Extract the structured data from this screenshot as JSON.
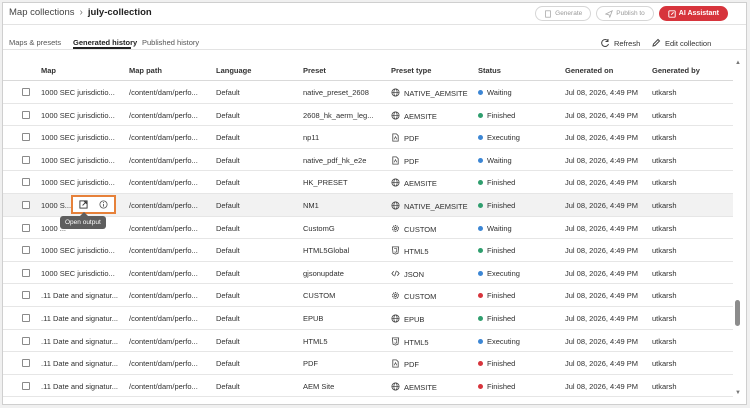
{
  "header": {
    "breadcrumb_parent": "Map collections",
    "breadcrumb_current": "july-collection",
    "generate_label": "Generate",
    "publish_label": "Publish to",
    "ai_label": "AI Assistant",
    "ai_color": "#d7343c"
  },
  "tabs": [
    {
      "label": "Maps & presets"
    },
    {
      "label": "Generated history"
    },
    {
      "label": "Published history"
    }
  ],
  "toolbar": {
    "refresh_label": "Refresh",
    "edit_label": "Edit collection"
  },
  "columns": [
    "Map",
    "Map path",
    "Language",
    "Preset",
    "Preset type",
    "Status",
    "Generated on",
    "Generated by"
  ],
  "status_colors": {
    "Waiting": "#3c86d4",
    "Finished": "#2f9e6e",
    "Executing": "#3c86d4"
  },
  "tooltip": "Open output",
  "rows": [
    {
      "map": "1000 SEC jurisdictio...",
      "path": "/content/dam/perfo...",
      "lang": "Default",
      "preset": "native_preset_2608",
      "type": "NATIVE_AEMSITE",
      "type_icon": "globe-icon",
      "status": "Waiting",
      "dot": "#3c86d4",
      "on": "Jul 08, 2026, 4:49 PM",
      "by": "utkarsh"
    },
    {
      "map": "1000 SEC jurisdictio...",
      "path": "/content/dam/perfo...",
      "lang": "Default",
      "preset": "2608_hk_aerm_leg...",
      "type": "AEMSITE",
      "type_icon": "globe-icon",
      "status": "Finished",
      "dot": "#2f9e6e",
      "on": "Jul 08, 2026, 4:49 PM",
      "by": "utkarsh"
    },
    {
      "map": "1000 SEC jurisdictio...",
      "path": "/content/dam/perfo...",
      "lang": "Default",
      "preset": "np11",
      "type": "PDF",
      "type_icon": "pdf-icon",
      "status": "Executing",
      "dot": "#3c86d4",
      "on": "Jul 08, 2026, 4:49 PM",
      "by": "utkarsh"
    },
    {
      "map": "1000 SEC jurisdictio...",
      "path": "/content/dam/perfo...",
      "lang": "Default",
      "preset": "native_pdf_hk_e2e",
      "type": "PDF",
      "type_icon": "pdf-icon",
      "status": "Waiting",
      "dot": "#3c86d4",
      "on": "Jul 08, 2026, 4:49 PM",
      "by": "utkarsh"
    },
    {
      "map": "1000 SEC jurisdictio...",
      "path": "/content/dam/perfo...",
      "lang": "Default",
      "preset": "HK_PRESET",
      "type": "AEMSITE",
      "type_icon": "globe-icon",
      "status": "Finished",
      "dot": "#2f9e6e",
      "on": "Jul 08, 2026, 4:49 PM",
      "by": "utkarsh"
    },
    {
      "map": "1000 S...",
      "path": "/content/dam/perfo...",
      "lang": "Default",
      "preset": "NM1",
      "type": "NATIVE_AEMSITE",
      "type_icon": "globe-icon",
      "status": "Finished",
      "dot": "#2f9e6e",
      "on": "Jul 08, 2026, 4:49 PM",
      "by": "utkarsh"
    },
    {
      "map": "1000 ...",
      "path": "/content/dam/perfo...",
      "lang": "Default",
      "preset": "CustomG",
      "type": "CUSTOM",
      "type_icon": "gear-icon",
      "status": "Waiting",
      "dot": "#3c86d4",
      "on": "Jul 08, 2026, 4:49 PM",
      "by": "utkarsh"
    },
    {
      "map": "1000 SEC jurisdictio...",
      "path": "/content/dam/perfo...",
      "lang": "Default",
      "preset": "HTML5Global",
      "type": "HTML5",
      "type_icon": "html5-icon",
      "status": "Finished",
      "dot": "#2f9e6e",
      "on": "Jul 08, 2026, 4:49 PM",
      "by": "utkarsh"
    },
    {
      "map": "1000 SEC jurisdictio...",
      "path": "/content/dam/perfo...",
      "lang": "Default",
      "preset": "gjsonupdate",
      "type": "JSON",
      "type_icon": "code-icon",
      "status": "Executing",
      "dot": "#3c86d4",
      "on": "Jul 08, 2026, 4:49 PM",
      "by": "utkarsh"
    },
    {
      "map": ".11 Date and signatur...",
      "path": "/content/dam/perfo...",
      "lang": "Default",
      "preset": "CUSTOM",
      "type": "CUSTOM",
      "type_icon": "gear-icon",
      "status": "Finished",
      "dot": "#d7343c",
      "on": "Jul 08, 2026, 4:49 PM",
      "by": "utkarsh"
    },
    {
      "map": ".11 Date and signatur...",
      "path": "/content/dam/perfo...",
      "lang": "Default",
      "preset": "EPUB",
      "type": "EPUB",
      "type_icon": "globe-icon",
      "status": "Finished",
      "dot": "#2f9e6e",
      "on": "Jul 08, 2026, 4:49 PM",
      "by": "utkarsh"
    },
    {
      "map": ".11 Date and signatur...",
      "path": "/content/dam/perfo...",
      "lang": "Default",
      "preset": "HTML5",
      "type": "HTML5",
      "type_icon": "html5-icon",
      "status": "Executing",
      "dot": "#3c86d4",
      "on": "Jul 08, 2026, 4:49 PM",
      "by": "utkarsh"
    },
    {
      "map": ".11 Date and signatur...",
      "path": "/content/dam/perfo...",
      "lang": "Default",
      "preset": "PDF",
      "type": "PDF",
      "type_icon": "pdf-icon",
      "status": "Finished",
      "dot": "#d7343c",
      "on": "Jul 08, 2026, 4:49 PM",
      "by": "utkarsh"
    },
    {
      "map": ".11 Date and signatur...",
      "path": "/content/dam/perfo...",
      "lang": "Default",
      "preset": "AEM Site",
      "type": "AEMSITE",
      "type_icon": "globe-icon",
      "status": "Finished",
      "dot": "#d7343c",
      "on": "Jul 08, 2026, 4:49 PM",
      "by": "utkarsh"
    }
  ]
}
